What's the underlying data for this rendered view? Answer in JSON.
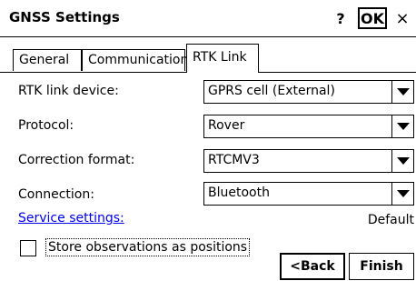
{
  "window": {
    "title": "GNSS Settings",
    "help_label": "?",
    "ok_label": "OK",
    "close_label": "×"
  },
  "tabs": [
    {
      "label": "General",
      "selected": false
    },
    {
      "label": "Communication",
      "selected": false
    },
    {
      "label": "RTK Link",
      "selected": true
    }
  ],
  "form": {
    "rtk_link_device": {
      "label": "RTK link device:",
      "value": "GPRS cell (External)"
    },
    "protocol": {
      "label": "Protocol:",
      "value": "Rover"
    },
    "correction_format": {
      "label": "Correction format:",
      "value": "RTCMV3"
    },
    "connection": {
      "label": "Connection:",
      "value": "Bluetooth"
    },
    "service_settings_link": "Service settings:",
    "service_settings_value": "Default",
    "store_observations": {
      "label": "Store observations as positions",
      "checked": false
    }
  },
  "buttons": {
    "back_label": "<Back",
    "finish_label": "Finish"
  }
}
